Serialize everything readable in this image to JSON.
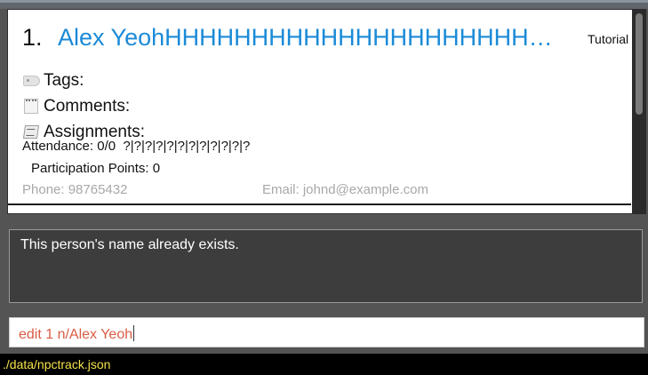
{
  "person_card": {
    "index": "1.",
    "name": "Alex YeohHHHHHHHHHHHHHHHHHHHHHHHHHHHHHHH",
    "tutorial": "Tutorial",
    "tags_label": "Tags:",
    "comments_label": "Comments:",
    "assignments_label": "Assignments:",
    "attendance": "Attendance: 0/0  ?|?|?|?|?|?|?|?|?|?|?|?",
    "participation": "Participation Points: 0",
    "phone": "Phone: 98765432",
    "email": "Email: johnd@example.com"
  },
  "icons": {
    "tags": "tag-icon",
    "comments": "notepad-icon",
    "assignments": "assignment-icon"
  },
  "result_display": {
    "message": "This person's name already exists."
  },
  "command_box": {
    "value": "edit 1 n/Alex Yeoh"
  },
  "status_bar": {
    "file_path": "./data/npctrack.json"
  },
  "colors": {
    "name": "#1b8ad8",
    "command_error": "#d95c44",
    "status_text": "#f4e24a",
    "background": "#545454"
  }
}
